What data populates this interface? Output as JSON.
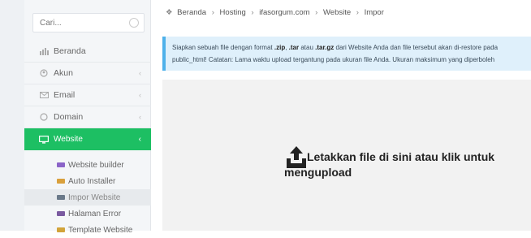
{
  "sidebar": {
    "search_placeholder": "Cari...",
    "menu": [
      {
        "label": "Beranda",
        "icon": "dashboard-icon"
      },
      {
        "label": "Akun",
        "icon": "user-icon"
      },
      {
        "label": "Email",
        "icon": "email-icon"
      },
      {
        "label": "Domain",
        "icon": "globe-icon"
      }
    ],
    "active_menu": {
      "label": "Website",
      "icon": "monitor-icon"
    },
    "submenu": [
      {
        "label": "Website builder",
        "color": "#8b64c8"
      },
      {
        "label": "Auto Installer",
        "color": "#d9a03c"
      },
      {
        "label": "Impor Website",
        "color": "#6b7a8a"
      },
      {
        "label": "Halaman Error",
        "color": "#7a5aa0"
      },
      {
        "label": "Template Website",
        "color": "#d2a43a"
      }
    ],
    "accent_color": "#1dbf63"
  },
  "breadcrumb": [
    "Beranda",
    "Hosting",
    "ifasorgum.com",
    "Website",
    "Impor"
  ],
  "alert": {
    "line1_prefix": "Siapkan sebuah file dengan format ",
    "ext1": ".zip",
    "sep1": ", ",
    "ext2": ".tar",
    "mid": " atau ",
    "ext3": ".tar.gz",
    "line1_suffix": " dari Website Anda dan file tersebut akan di-restore pada",
    "line2": "public_html! Catatan: Lama waktu upload tergantung pada ukuran file Anda. Ukuran maksimum yang diperboleh"
  },
  "dropzone": {
    "text": "Letakkan file di sini atau klik untuk mengupload"
  }
}
